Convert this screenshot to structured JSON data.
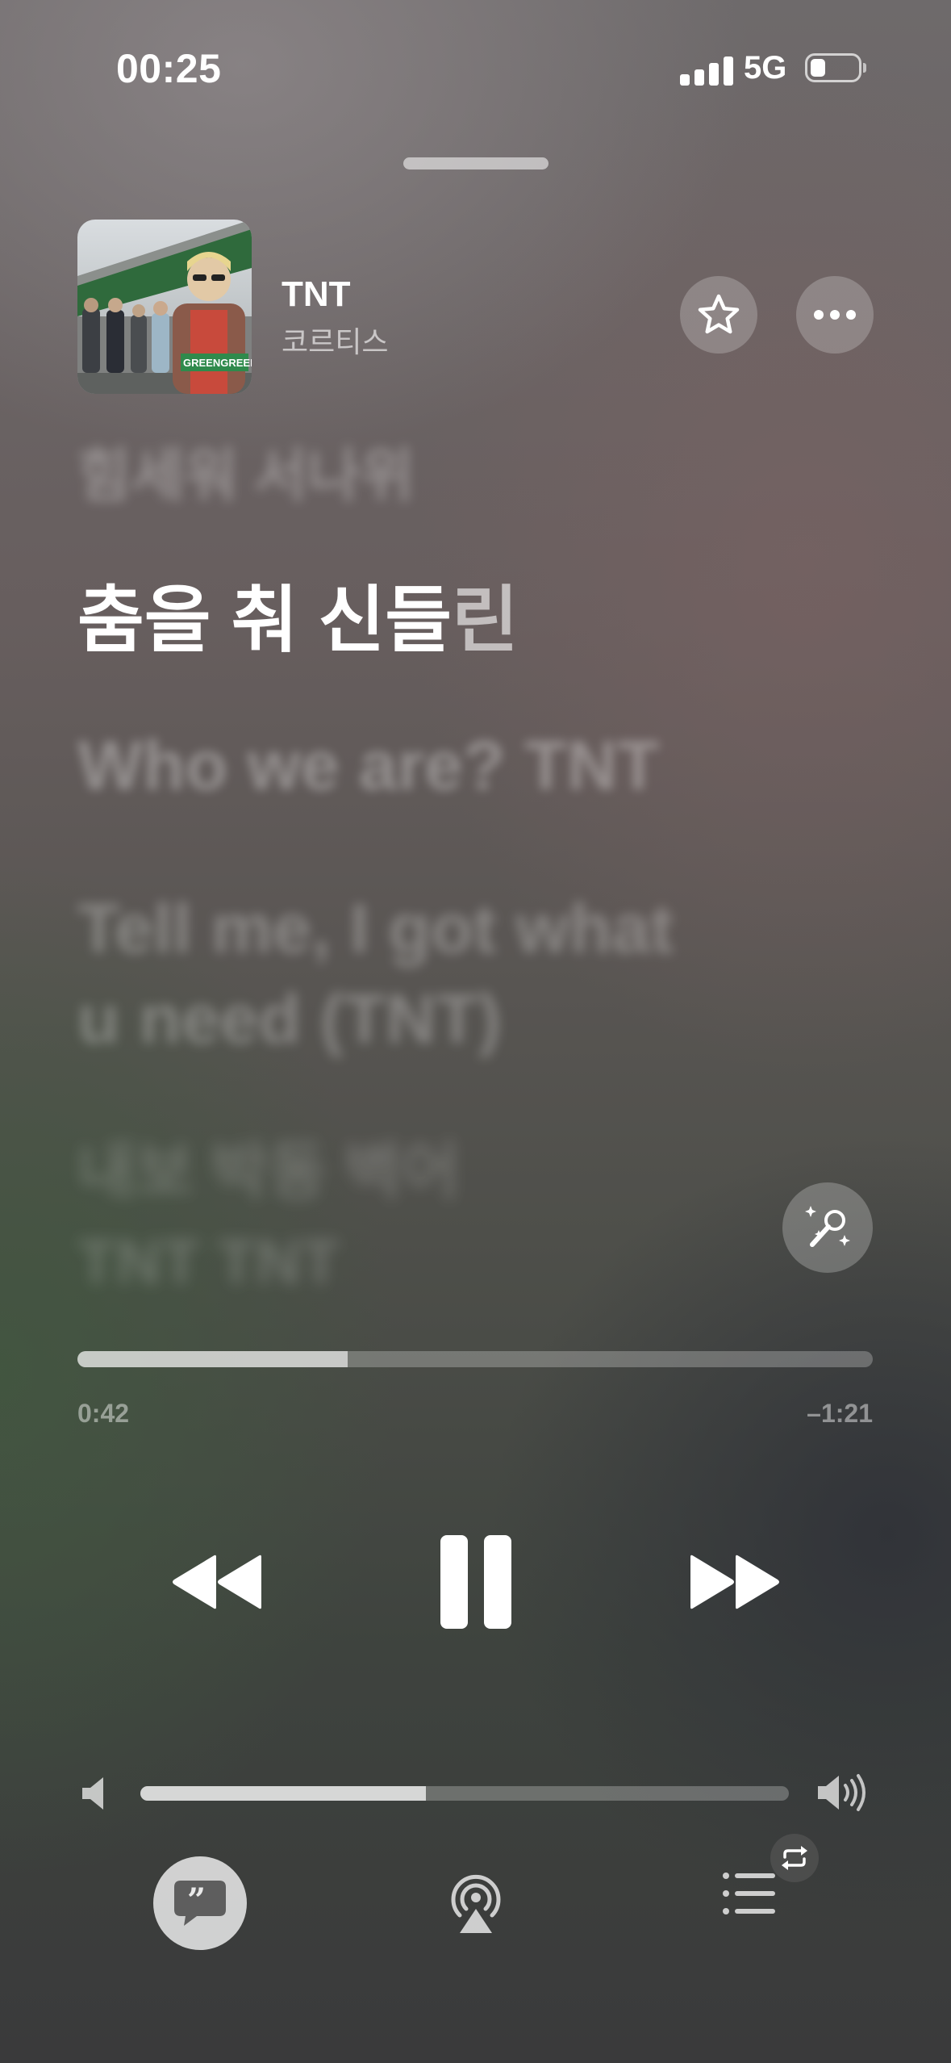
{
  "status_bar": {
    "time": "00:25",
    "network": "5G"
  },
  "now_playing": {
    "title": "TNT",
    "artist": "코르티스",
    "album_art_text": "GREENGREEN"
  },
  "lyrics": {
    "previous": "힘세워 서나위",
    "current_sung": "춤을 춰 신들",
    "current_unsung": "린",
    "next": [
      "Who we are? TNT",
      "Tell me, I got what",
      "u need (TNT)",
      "내보 박동 벽어",
      "TNT TNT"
    ]
  },
  "playback": {
    "elapsed": "0:42",
    "remaining": "–1:21",
    "progress_fraction": 0.34,
    "state": "playing"
  },
  "volume": {
    "level_fraction": 0.44
  },
  "icons": [
    "star-icon",
    "more-icon",
    "sing-mic-icon",
    "rewind-icon",
    "pause-icon",
    "forward-icon",
    "volume-low-icon",
    "volume-high-icon",
    "lyrics-quote-icon",
    "airplay-icon",
    "queue-list-icon",
    "repeat-icon"
  ]
}
